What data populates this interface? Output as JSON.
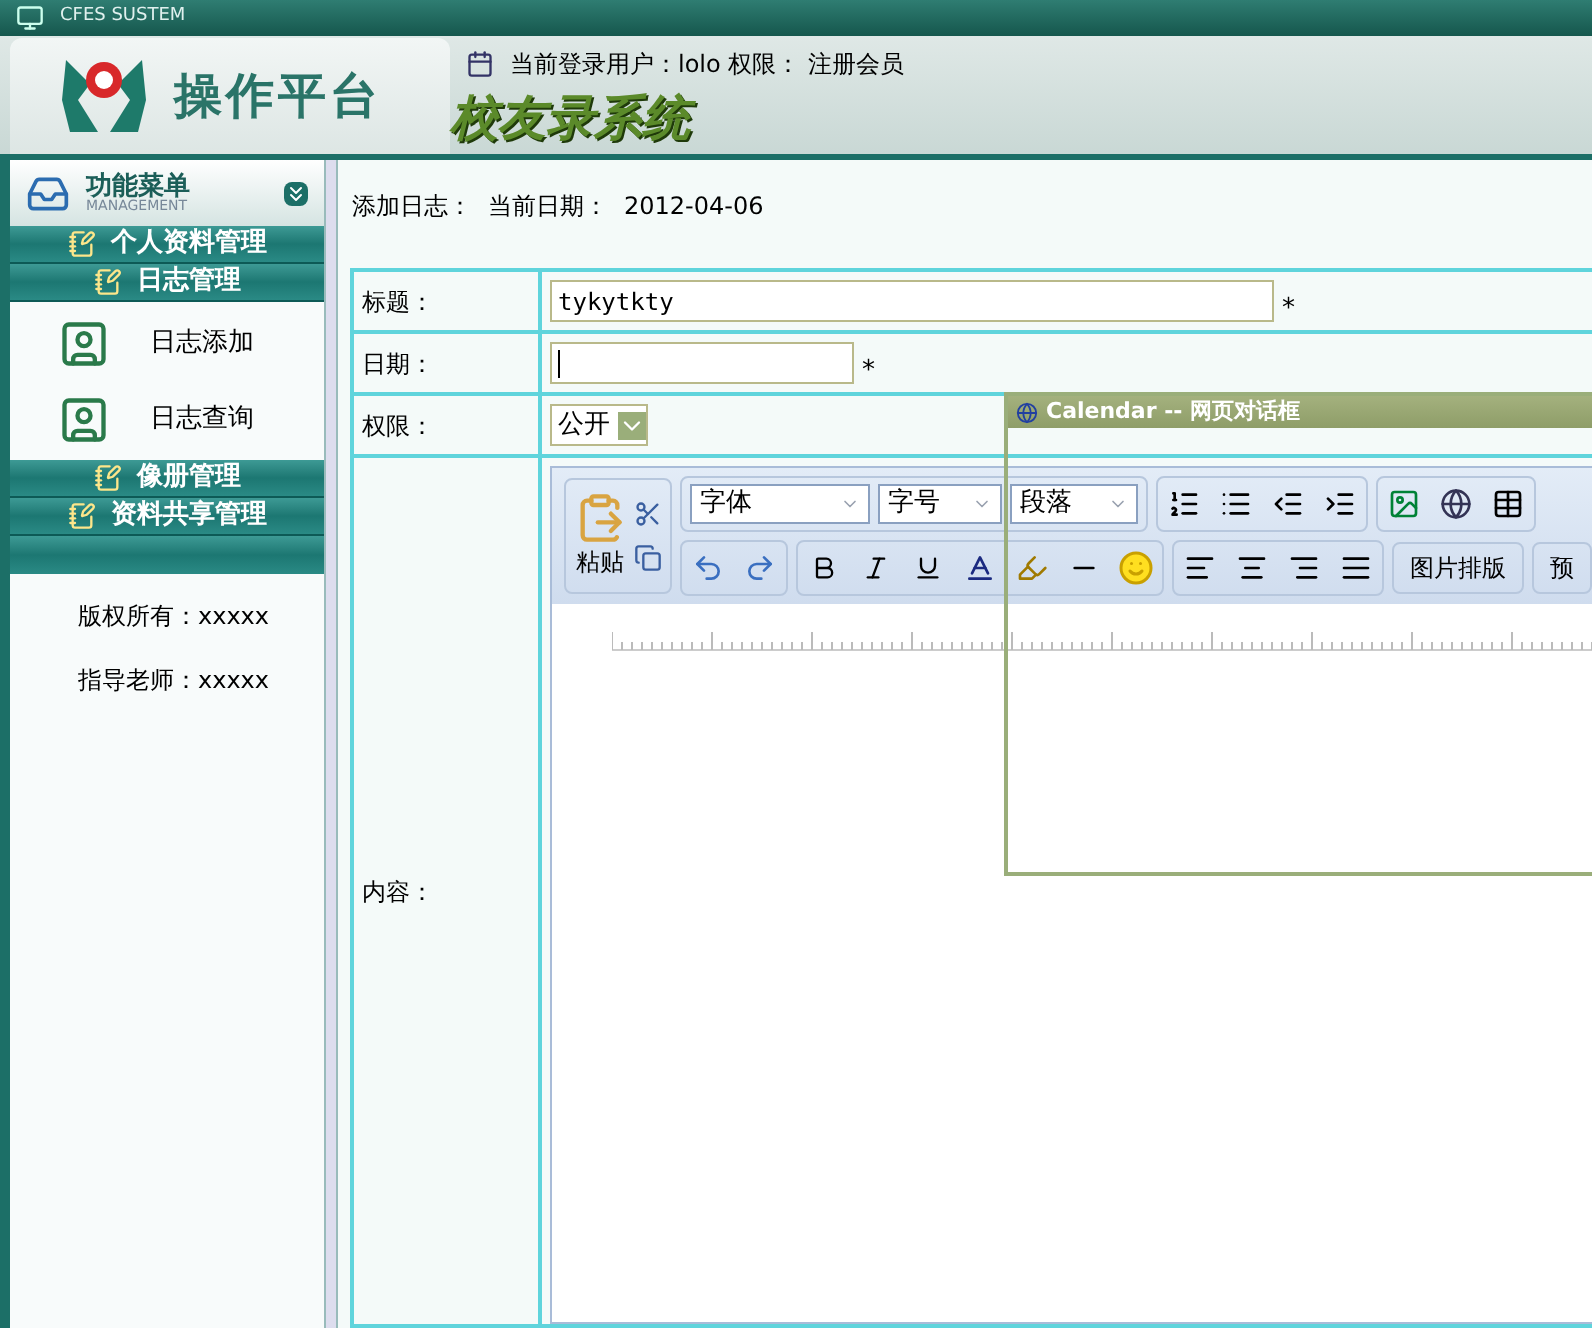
{
  "window": {
    "title": "CFES SUSTEM"
  },
  "header": {
    "logo_text": "操作平台",
    "user_info": "当前登录用户：lolo 权限： 注册会员",
    "system_title": "校友录系统"
  },
  "sidebar": {
    "title": "功能菜单",
    "subtitle": "MANAGEMENT",
    "sections": [
      {
        "label": "个人资料管理"
      },
      {
        "label": "日志管理",
        "children": [
          {
            "label": "日志添加"
          },
          {
            "label": "日志查询"
          }
        ]
      },
      {
        "label": "像册管理"
      },
      {
        "label": "资料共享管理"
      }
    ],
    "footer": [
      "版权所有：xxxxx",
      "指导老师：xxxxx"
    ]
  },
  "page": {
    "heading": "添加日志：",
    "date_label": "当前日期：",
    "date": "2012-04-06"
  },
  "form": {
    "rows": [
      {
        "kind": "text",
        "label": "标题：",
        "value": "tykytkty",
        "required_mark": "*",
        "focused": false
      },
      {
        "kind": "text",
        "label": "日期：",
        "required_mark": "*",
        "focused": true
      },
      {
        "kind": "select",
        "label": "权限：",
        "value": "公开"
      },
      {
        "kind": "editor",
        "label": "内容："
      }
    ]
  },
  "editor": {
    "paste_label": "粘贴",
    "font_select": "字体",
    "size_select": "字号",
    "paragraph_select": "段落",
    "image_layout": "图片排版",
    "preview": "预"
  },
  "dialog": {
    "title": "Calendar -- 网页对话框"
  }
}
